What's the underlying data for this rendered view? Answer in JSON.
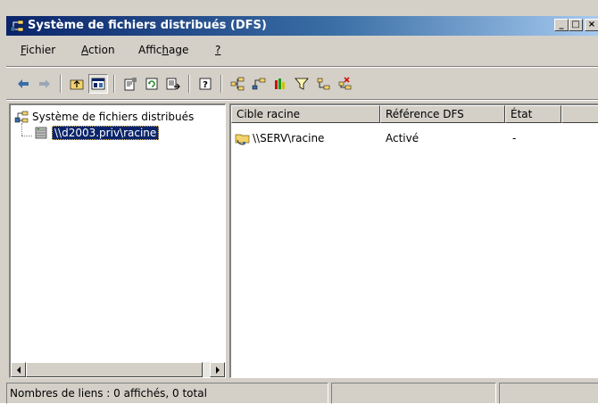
{
  "window": {
    "title": "Système de fichiers distribués (DFS)",
    "minimize_glyph": "_",
    "maximize_glyph": "□",
    "close_glyph": "×"
  },
  "menu": [
    {
      "label": "Fichier",
      "accel": "F"
    },
    {
      "label": "Action",
      "accel": "A"
    },
    {
      "label": "Affichage",
      "accel": "h"
    },
    {
      "label": "?",
      "accel": "?"
    }
  ],
  "toolbar": {
    "buttons": [
      "back-icon",
      "forward-icon",
      "up-folder-icon",
      "show-hide-tree-icon",
      "properties-icon",
      "refresh-icon",
      "export-list-icon",
      "help-icon",
      "new-root-icon",
      "new-link-icon",
      "status-icon",
      "filter-icon",
      "add-target-icon",
      "remove-icon"
    ]
  },
  "tree": {
    "root_label": "Système de fichiers distribués",
    "child_label": "\\\\d2003.priv\\racine"
  },
  "list": {
    "columns": [
      "Cible racine",
      "Référence DFS",
      "État"
    ],
    "rows": [
      {
        "target": "\\\\SERV\\racine",
        "reference": "Activé",
        "state": "-"
      }
    ]
  },
  "status": {
    "text": "Nombres de liens : 0 affichés, 0 total"
  },
  "colors": {
    "titlebar_start": "#0a246a",
    "titlebar_end": "#a6caf0",
    "face": "#d4d0c8",
    "selection": "#0a246a"
  }
}
